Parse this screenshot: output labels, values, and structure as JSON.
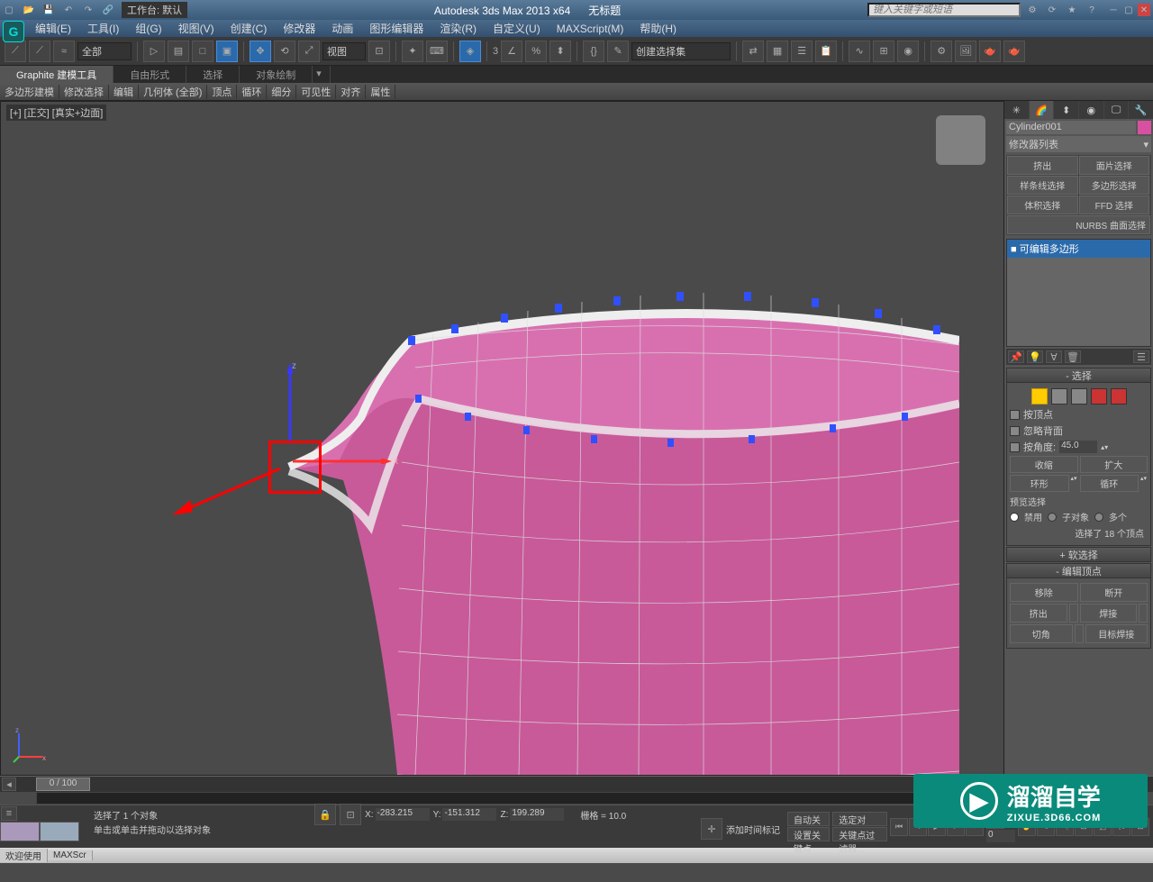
{
  "title": {
    "app": "Autodesk 3ds Max  2013 x64",
    "doc": "无标题",
    "workspace": "工作台: 默认",
    "search_ph": "键入关键字或短语"
  },
  "menu": [
    "编辑(E)",
    "工具(I)",
    "组(G)",
    "视图(V)",
    "创建(C)",
    "修改器",
    "动画",
    "图形编辑器",
    "渲染(R)",
    "自定义(U)",
    "MAXScript(M)",
    "帮助(H)"
  ],
  "toolbar": {
    "filter": "全部",
    "refcoord": "视图",
    "selset": "创建选择集",
    "snapangle": "3"
  },
  "ribbon": {
    "tabs": [
      "Graphite 建模工具",
      "自由形式",
      "选择",
      "对象绘制"
    ],
    "bar": [
      "多边形建模",
      "修改选择",
      "编辑",
      "几何体 (全部)",
      "顶点",
      "循环",
      "细分",
      "可见性",
      "对齐",
      "属性"
    ]
  },
  "viewport": {
    "label": "[+] [正交] [真实+边面]"
  },
  "panel": {
    "object": "Cylinder001",
    "modlist": "修改器列表",
    "btns": [
      "挤出",
      "面片选择",
      "样条线选择",
      "多边形选择",
      "体积选择",
      "FFD 选择",
      "NURBS 曲面选择"
    ],
    "stack": "■ 可编辑多边形",
    "selection": {
      "title": "选择",
      "byvert": "按顶点",
      "ignoreback": "忽略背面",
      "byangle": "按角度:",
      "angle": "45.0",
      "shrink": "收缩",
      "grow": "扩大",
      "ring": "环形",
      "loop": "循环",
      "preview": "预览选择",
      "off": "禁用",
      "subobj": "子对象",
      "multi": "多个",
      "count": "选择了 18 个顶点"
    },
    "soft": "软选择",
    "editv": {
      "title": "编辑顶点",
      "remove": "移除",
      "break": "断开",
      "extrude": "挤出",
      "weld": "焊接",
      "chamfer": "切角",
      "target": "目标焊接"
    }
  },
  "timeline": {
    "pos": "0 / 100"
  },
  "status": {
    "selinfo": "选择了 1 个对象",
    "prompt": "单击或单击并拖动以选择对象",
    "x": "-283.215",
    "y": "-151.312",
    "z": "199.289",
    "grid": "栅格 = 10.0",
    "autokey": "自动关键点",
    "setkey": "设置关键点",
    "keyfilter": "关键点过滤器...",
    "seldlg": "选定对",
    "addtime": "添加时间标记"
  },
  "footer": {
    "welcome": "欢迎使用",
    "script": "MAXScr"
  },
  "watermark": {
    "main": "溜溜自学",
    "sub": "ZIXUE.3D66.COM"
  }
}
